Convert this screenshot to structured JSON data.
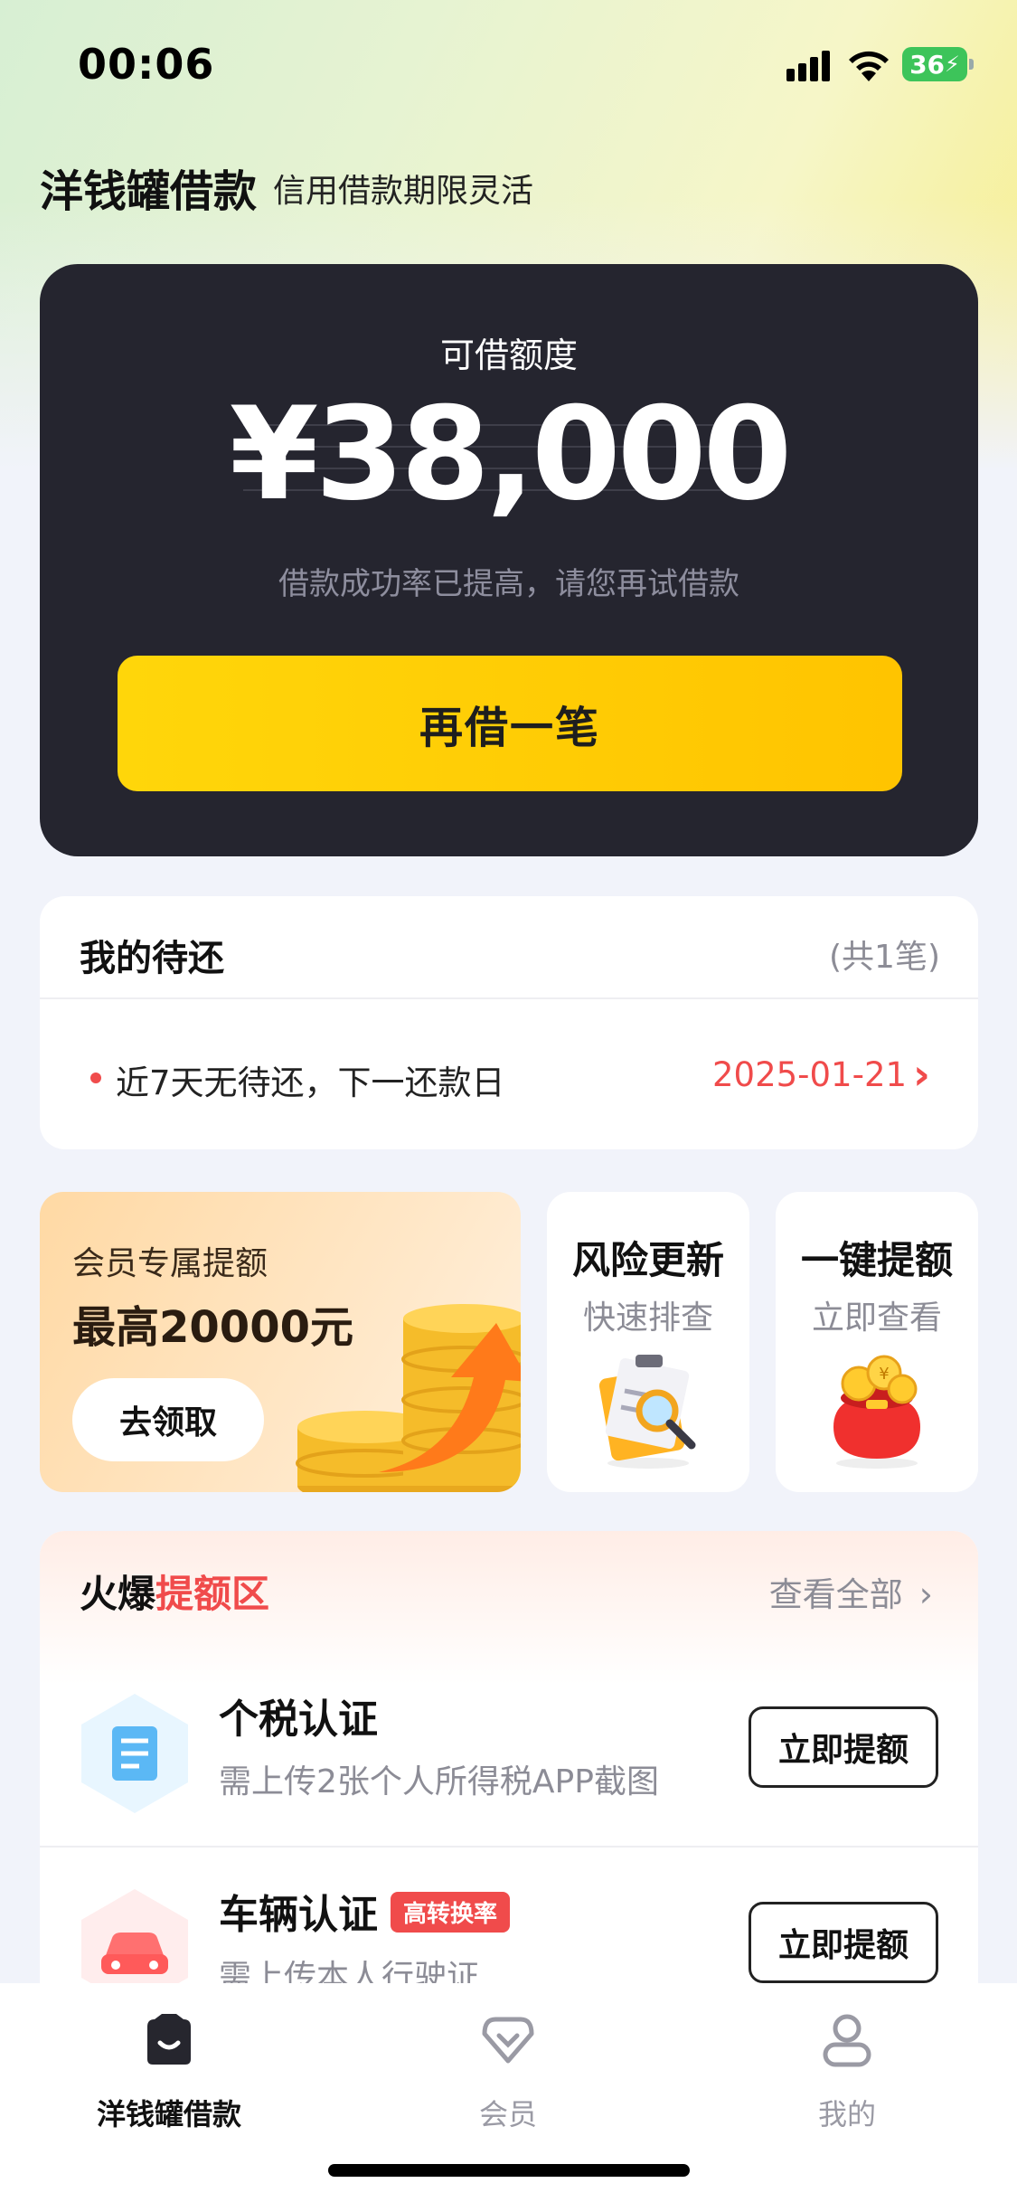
{
  "status_bar": {
    "time": "00:06",
    "battery": "36"
  },
  "header": {
    "title": "洋钱罐借款",
    "subtitle": "信用借款期限灵活"
  },
  "credit": {
    "label": "可借额度",
    "amount": "¥38,000",
    "hint": "借款成功率已提高，请您再试借款",
    "button": "再借一笔"
  },
  "repay": {
    "title": "我的待还",
    "count": "(共1笔)",
    "notice": "近7天无待还，下一还款日",
    "next_date": "2025-01-21"
  },
  "promo": {
    "subtitle": "会员专属提额",
    "headline": "最高20000元",
    "button": "去领取"
  },
  "tiles": [
    {
      "title": "风险更新",
      "subtitle": "快速排查"
    },
    {
      "title": "一键提额",
      "subtitle": "立即查看"
    }
  ],
  "hot_zone": {
    "title_black": "火爆",
    "title_red": "提额区",
    "view_all": "查看全部",
    "items": [
      {
        "name": "个税认证",
        "desc": "需上传2张个人所得税APP截图",
        "button": "立即提额",
        "badge": ""
      },
      {
        "name": "车辆认证",
        "desc": "需上传本人行驶证",
        "button": "立即提额",
        "badge": "高转换率"
      }
    ]
  },
  "tabbar": {
    "items": [
      {
        "label": "洋钱罐借款",
        "active": true
      },
      {
        "label": "会员",
        "active": false
      },
      {
        "label": "我的",
        "active": false
      }
    ]
  },
  "colors": {
    "accent_yellow": "#FFD000",
    "alert_red": "#F04B4B",
    "card_dark": "#25252F"
  }
}
